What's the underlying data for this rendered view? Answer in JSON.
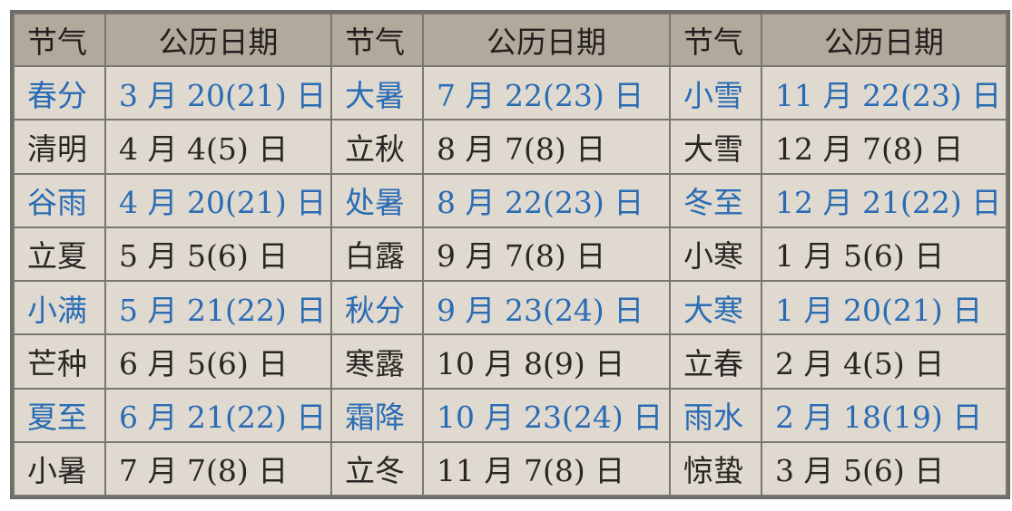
{
  "table": {
    "headers": [
      "节气",
      "公历日期",
      "节气",
      "公历日期",
      "节气",
      "公历日期"
    ],
    "rows": [
      {
        "highlight": true,
        "cells": [
          "春分",
          "3 月 20(21) 日",
          "大暑",
          "7 月 22(23) 日",
          "小雪",
          "11 月 22(23) 日"
        ]
      },
      {
        "highlight": false,
        "cells": [
          "清明",
          "4 月 4(5) 日",
          "立秋",
          "8 月 7(8) 日",
          "大雪",
          "12 月 7(8) 日"
        ]
      },
      {
        "highlight": true,
        "cells": [
          "谷雨",
          "4 月 20(21) 日",
          "处暑",
          "8 月 22(23) 日",
          "冬至",
          "12 月 21(22) 日"
        ]
      },
      {
        "highlight": false,
        "cells": [
          "立夏",
          "5 月 5(6) 日",
          "白露",
          "9 月 7(8) 日",
          "小寒",
          "1 月 5(6) 日"
        ]
      },
      {
        "highlight": true,
        "cells": [
          "小满",
          "5 月 21(22) 日",
          "秋分",
          "9 月 23(24) 日",
          "大寒",
          "1 月 20(21) 日"
        ]
      },
      {
        "highlight": false,
        "cells": [
          "芒种",
          "6 月 5(6) 日",
          "寒露",
          "10 月 8(9) 日",
          "立春",
          "2 月 4(5) 日"
        ]
      },
      {
        "highlight": true,
        "cells": [
          "夏至",
          "6 月 21(22) 日",
          "霜降",
          "10 月 23(24) 日",
          "雨水",
          "2 月 18(19) 日"
        ]
      },
      {
        "highlight": false,
        "cells": [
          "小暑",
          "7 月 7(8) 日",
          "立冬",
          "11 月 7(8) 日",
          "惊蛰",
          "3 月 5(6) 日"
        ]
      }
    ]
  },
  "colors": {
    "background": "#dfd9d0",
    "header_background": "#b2a99d",
    "text": "#2a2623",
    "highlight_text": "#2a6cb4",
    "border": "#7a7672"
  }
}
